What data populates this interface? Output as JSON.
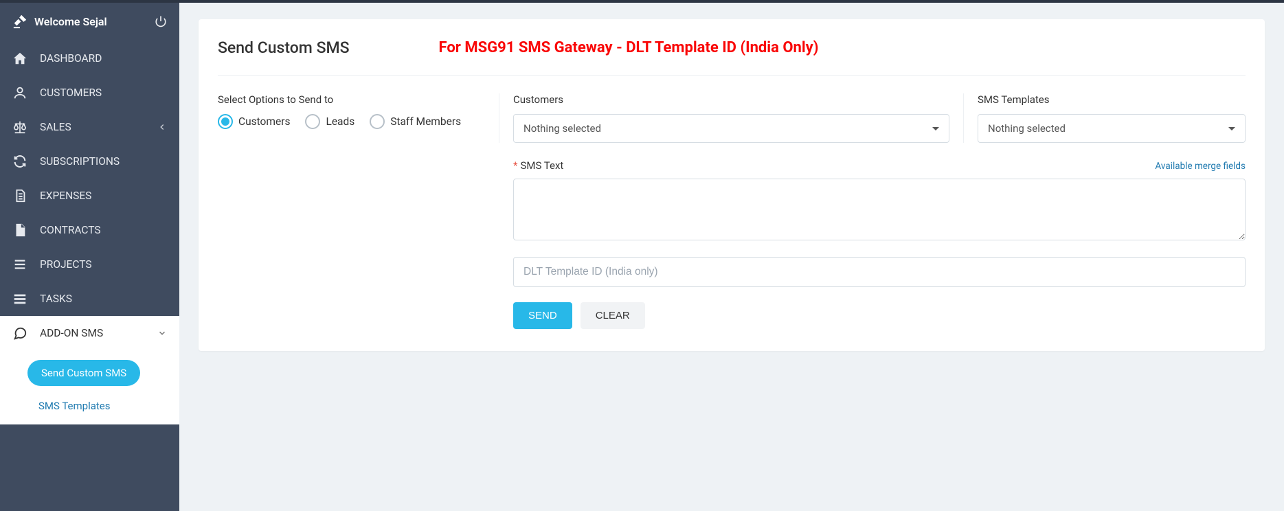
{
  "welcome": "Welcome Sejal",
  "nav": {
    "dashboard": "DASHBOARD",
    "customers": "CUSTOMERS",
    "sales": "SALES",
    "subscriptions": "SUBSCRIPTIONS",
    "expenses": "EXPENSES",
    "contracts": "CONTRACTS",
    "projects": "PROJECTS",
    "tasks": "TASKS",
    "addon_sms": "ADD-ON SMS",
    "sub_send_custom": "Send Custom SMS",
    "sub_templates": "SMS Templates"
  },
  "page": {
    "title": "Send Custom SMS",
    "warning": "For MSG91 SMS Gateway  - DLT Template ID (India Only)"
  },
  "form": {
    "select_label": "Select Options to Send to",
    "opt_customers": "Customers",
    "opt_leads": "Leads",
    "opt_staff": "Staff Members",
    "customers_label": "Customers",
    "templates_label": "SMS Templates",
    "nothing_selected": "Nothing selected",
    "sms_text_label": "SMS Text",
    "merge_link": "Available merge fields",
    "dlt_placeholder": "DLT Template ID (India only)",
    "send": "SEND",
    "clear": "CLEAR"
  }
}
